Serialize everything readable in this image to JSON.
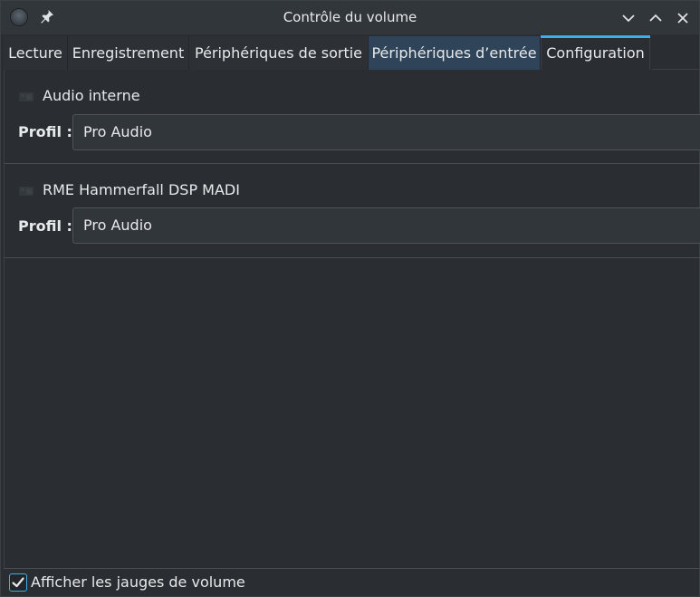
{
  "window": {
    "title": "Contrôle du volume"
  },
  "tabs": [
    {
      "label": "Lecture"
    },
    {
      "label": "Enregistrement"
    },
    {
      "label": "Périphériques de sortie"
    },
    {
      "label": "Périphériques d’entrée"
    },
    {
      "label": "Configuration"
    }
  ],
  "devices": [
    {
      "name": "Audio interne",
      "profile_label": "Profil :",
      "profile_value": "Pro Audio"
    },
    {
      "name": "RME Hammerfall DSP MADI",
      "profile_label": "Profil :",
      "profile_value": "Pro Audio"
    }
  ],
  "footer": {
    "show_meters_label": "Afficher les jauges de volume",
    "show_meters_checked": true
  },
  "colors": {
    "accent": "#3daee9",
    "background": "#2a2e32",
    "hover_tab": "#2f4458"
  },
  "icons": [
    "app-icon",
    "pin-icon",
    "minimize-icon",
    "maximize-icon",
    "close-icon",
    "sound-card-icon",
    "checkmark-icon"
  ]
}
